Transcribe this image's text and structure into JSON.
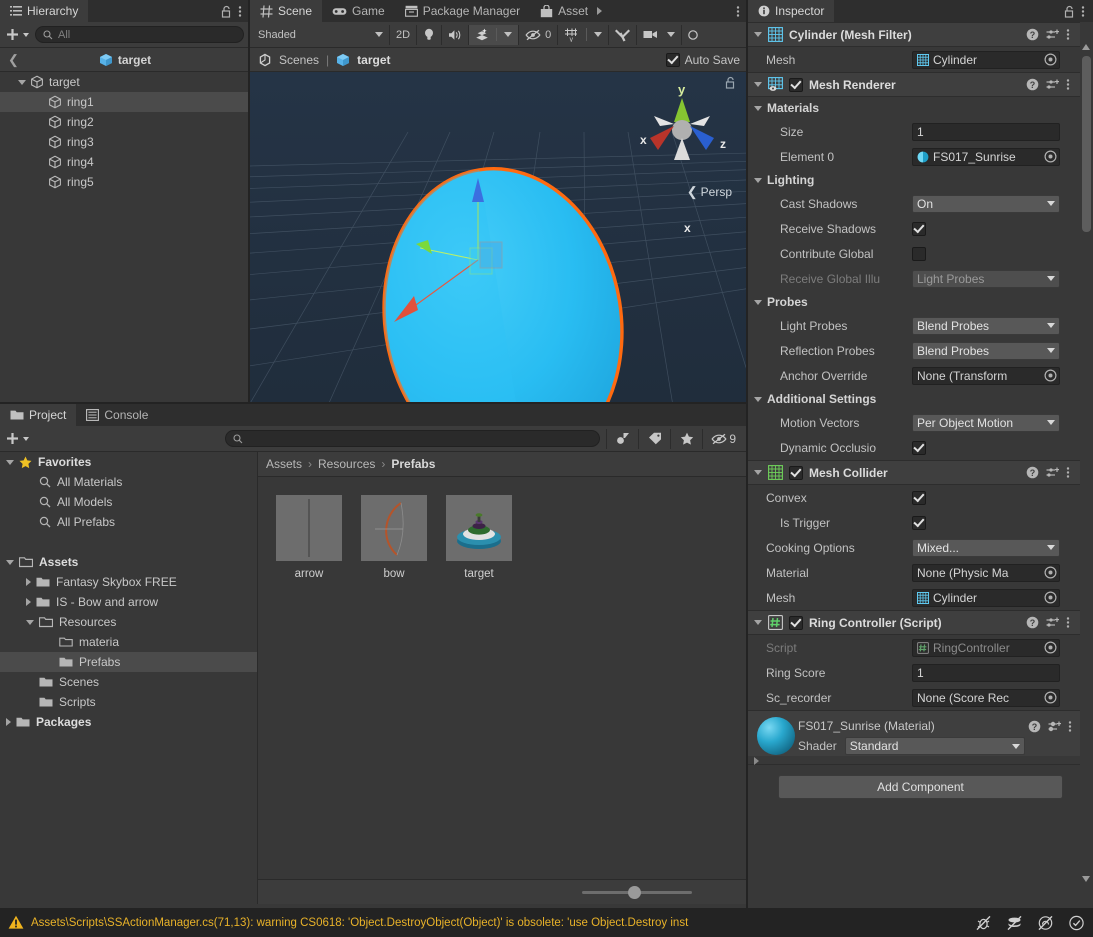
{
  "hierarchy": {
    "tab_label": "Hierarchy",
    "add_label": "+",
    "search_placeholder": "All",
    "breadcrumb_title": "target",
    "items": [
      {
        "label": "target",
        "depth": 1,
        "expandable": true,
        "selected": false
      },
      {
        "label": "ring1",
        "depth": 2,
        "expandable": false,
        "selected": true
      },
      {
        "label": "ring2",
        "depth": 2,
        "expandable": false,
        "selected": false
      },
      {
        "label": "ring3",
        "depth": 2,
        "expandable": false,
        "selected": false
      },
      {
        "label": "ring4",
        "depth": 2,
        "expandable": false,
        "selected": false
      },
      {
        "label": "ring5",
        "depth": 2,
        "expandable": false,
        "selected": false
      }
    ]
  },
  "scene": {
    "tabs": [
      {
        "label": "Scene",
        "icon": "grid-icon",
        "active": true
      },
      {
        "label": "Game",
        "icon": "gamepad-icon",
        "active": false
      },
      {
        "label": "Package Manager",
        "icon": "package-icon",
        "active": false
      },
      {
        "label": "Asset",
        "icon": "store-icon",
        "active": false
      }
    ],
    "toolbar": {
      "draw_mode": "Shaded",
      "two_d": "2D",
      "light_icon": "lightbulb-icon",
      "audio_icon": "speaker-icon",
      "fx_icon": "effects-icon",
      "hidden_count": "0",
      "grid_icon": "grid-visibility-icon",
      "tools_icon": "gizmos-tools-icon",
      "camera_icon": "scene-camera-icon"
    },
    "path_left": "Scenes",
    "path_object": "target",
    "auto_save_label": "Auto Save",
    "auto_save_checked": true,
    "gizmo": {
      "axis_y": "y",
      "axis_x": "x",
      "axis_z": "z",
      "projection": "Persp"
    }
  },
  "project": {
    "tabs": [
      {
        "label": "Project",
        "icon": "folder-icon",
        "active": true
      },
      {
        "label": "Console",
        "icon": "console-icon",
        "active": false
      }
    ],
    "add_label": "+",
    "search_placeholder": "",
    "filter_icons": [
      "object-type-filter-icon",
      "label-filter-icon",
      "favorite-filter-icon"
    ],
    "hidden_count": "9",
    "tree": [
      {
        "label": "Favorites",
        "depth": 0,
        "icon": "star-icon",
        "expand": "down",
        "bold": true,
        "selected": false
      },
      {
        "label": "All Materials",
        "depth": 1,
        "icon": "search-small-icon",
        "expand": "none",
        "bold": false,
        "selected": false
      },
      {
        "label": "All Models",
        "depth": 1,
        "icon": "search-small-icon",
        "expand": "none",
        "bold": false,
        "selected": false
      },
      {
        "label": "All Prefabs",
        "depth": 1,
        "icon": "search-small-icon",
        "expand": "none",
        "bold": false,
        "selected": false
      },
      {
        "label": "",
        "depth": 0,
        "icon": "none",
        "expand": "none",
        "bold": false,
        "selected": false
      },
      {
        "label": "Assets",
        "depth": 0,
        "icon": "folder-open-icon",
        "expand": "down",
        "bold": true,
        "selected": false
      },
      {
        "label": "Fantasy Skybox FREE",
        "depth": 1,
        "icon": "folder-icon",
        "expand": "right",
        "bold": false,
        "selected": false
      },
      {
        "label": "IS - Bow and arrow",
        "depth": 1,
        "icon": "folder-icon",
        "expand": "right",
        "bold": false,
        "selected": false
      },
      {
        "label": "Resources",
        "depth": 1,
        "icon": "folder-open-icon",
        "expand": "down",
        "bold": false,
        "selected": false
      },
      {
        "label": "materia",
        "depth": 2,
        "icon": "folder-empty-icon",
        "expand": "none",
        "bold": false,
        "selected": false
      },
      {
        "label": "Prefabs",
        "depth": 2,
        "icon": "folder-icon",
        "expand": "none",
        "bold": false,
        "selected": true
      },
      {
        "label": "Scenes",
        "depth": 1,
        "icon": "folder-icon",
        "expand": "none",
        "bold": false,
        "selected": false
      },
      {
        "label": "Scripts",
        "depth": 1,
        "icon": "folder-icon",
        "expand": "none",
        "bold": false,
        "selected": false
      },
      {
        "label": "Packages",
        "depth": 0,
        "icon": "folder-icon",
        "expand": "right",
        "bold": true,
        "selected": false
      }
    ],
    "breadcrumbs": [
      "Assets",
      "Resources",
      "Prefabs"
    ],
    "assets": [
      {
        "name": "arrow",
        "kind": "arrow-thumb"
      },
      {
        "name": "bow",
        "kind": "bow-thumb"
      },
      {
        "name": "target",
        "kind": "target-thumb"
      }
    ],
    "zoom_value": "42"
  },
  "inspector": {
    "tab_label": "Inspector",
    "lock_icon": "lock-open-icon",
    "menu_icon": "kebab-menu-icon",
    "components": [
      {
        "title": "Cylinder (Mesh Filter)",
        "icon": "mesh-filter-icon",
        "has_toggle": false,
        "enabled": false,
        "rows": [
          {
            "type": "object",
            "label": "Mesh",
            "value": "Cylinder",
            "icon": "mesh-icon",
            "indent": 0
          }
        ]
      },
      {
        "title": "Mesh Renderer",
        "icon": "mesh-renderer-icon",
        "has_toggle": true,
        "enabled": true,
        "rows": [
          {
            "type": "section",
            "label": "Materials"
          },
          {
            "type": "text",
            "label": "Size",
            "value": "1",
            "indent": 1
          },
          {
            "type": "object",
            "label": "Element 0",
            "value": "FS017_Sunrise",
            "icon": "material-icon",
            "indent": 1
          },
          {
            "type": "section",
            "label": "Lighting"
          },
          {
            "type": "dropdown",
            "label": "Cast Shadows",
            "value": "On",
            "indent": 1
          },
          {
            "type": "check",
            "label": "Receive Shadows",
            "checked": true,
            "indent": 1
          },
          {
            "type": "check",
            "label": "Contribute Global",
            "checked": false,
            "indent": 1
          },
          {
            "type": "dropdown",
            "label": "Receive Global Illu",
            "value": "Light Probes",
            "indent": 1,
            "dim": true
          },
          {
            "type": "section",
            "label": "Probes"
          },
          {
            "type": "dropdown",
            "label": "Light Probes",
            "value": "Blend Probes",
            "indent": 1
          },
          {
            "type": "dropdown",
            "label": "Reflection Probes",
            "value": "Blend Probes",
            "indent": 1
          },
          {
            "type": "object",
            "label": "Anchor Override",
            "value": "None (Transform",
            "icon": "none",
            "indent": 1
          },
          {
            "type": "section",
            "label": "Additional Settings"
          },
          {
            "type": "dropdown",
            "label": "Motion Vectors",
            "value": "Per Object Motion",
            "indent": 1
          },
          {
            "type": "check",
            "label": "Dynamic Occlusio",
            "checked": true,
            "indent": 1
          }
        ]
      },
      {
        "title": "Mesh Collider",
        "icon": "mesh-collider-icon",
        "has_toggle": true,
        "enabled": true,
        "rows": [
          {
            "type": "check",
            "label": "Convex",
            "checked": true,
            "indent": 0
          },
          {
            "type": "check",
            "label": "Is Trigger",
            "checked": true,
            "indent": 1
          },
          {
            "type": "dropdown",
            "label": "Cooking Options",
            "value": "Mixed...",
            "indent": 0
          },
          {
            "type": "object",
            "label": "Material",
            "value": "None (Physic Ma",
            "icon": "none",
            "indent": 0
          },
          {
            "type": "object",
            "label": "Mesh",
            "value": "Cylinder",
            "icon": "mesh-icon",
            "indent": 0
          }
        ]
      },
      {
        "title": "Ring Controller (Script)",
        "icon": "script-icon",
        "has_toggle": true,
        "enabled": true,
        "rows": [
          {
            "type": "object",
            "label": "Script",
            "value": "RingController",
            "icon": "script-small-icon",
            "indent": 0,
            "dim": true
          },
          {
            "type": "text",
            "label": "Ring Score",
            "value": "1",
            "indent": 0
          },
          {
            "type": "object",
            "label": "Sc_recorder",
            "value": "None (Score Rec",
            "icon": "none",
            "indent": 0
          }
        ]
      }
    ],
    "material": {
      "title": "FS017_Sunrise (Material)",
      "shader_label": "Shader",
      "shader_value": "Standard"
    },
    "add_component_label": "Add Component"
  },
  "status": {
    "warning_icon": "warning-triangle-icon",
    "message": "Assets\\Scripts\\SSActionManager.cs(71,13): warning CS0618: 'Object.DestroyObject(Object)' is obsolete: 'use Object.Destroy inst",
    "icons": [
      "debug-off-icon",
      "collab-off-icon",
      "cloud-off-icon",
      "check-circle-icon"
    ]
  },
  "colors": {
    "panel_bg": "#383838",
    "header_bg": "#3c3c3c",
    "tab_inactive": "#2e2e2e",
    "field_bg": "#2a2a2a",
    "dropdown_bg": "#585858",
    "selection": "#4b4b4b",
    "viewport_bg": "#22303f",
    "accent_orange": "#ff6a10",
    "object_cyan": "#29c0f2",
    "warning_yellow": "#e8b229",
    "status_bg": "#232323"
  }
}
